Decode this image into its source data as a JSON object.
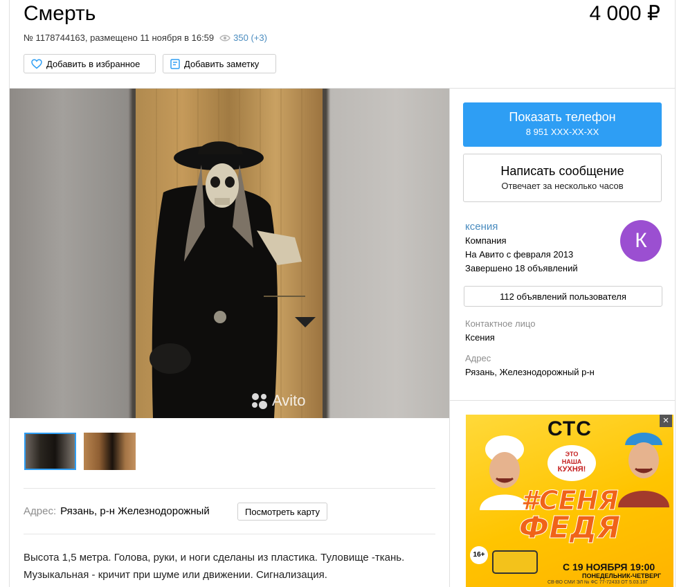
{
  "listing": {
    "title": "Смерть",
    "price": "4 000 ₽",
    "meta": "№ 1178744163, размещено 11 ноября в 16:59",
    "views": "350 (+3)",
    "favorite_label": "Добавить в избранное",
    "note_label": "Добавить заметку"
  },
  "gallery": {
    "watermark": "Avito"
  },
  "address_row": {
    "label": "Адрес:",
    "value": "Рязань, р-н Железнодорожный",
    "map_button": "Посмотреть карту"
  },
  "description": {
    "line1": "Высота 1,5 метра. Голова, руки, и ноги сделаны из пластика. Туловище -ткань.",
    "line2": "Музыкальная - кричит при шуме или движении. Сигнализация."
  },
  "contact": {
    "phone_button": "Показать телефон",
    "phone_masked": "8 951 XXX-XX-XX",
    "message_button": "Написать сообщение",
    "message_sub": "Отвечает за несколько часов"
  },
  "seller": {
    "name": "ксения",
    "type": "Компания",
    "since": "На Авито с февраля 2013",
    "completed": "Завершено 18 объявлений",
    "avatar_letter": "К",
    "listings_button": "112 объявлений пользователя",
    "contact_label": "Контактное лицо",
    "contact_value": "Ксения",
    "address_label": "Адрес",
    "address_value": "Рязань, Железнодорожный р-н"
  },
  "ad": {
    "brand": "СТС",
    "slogan_1": "ЭТО",
    "slogan_2": "НАША",
    "slogan_3": "КУХНЯ!",
    "show_line1": "#СЕНЯ",
    "show_line2": "ФЕДЯ",
    "age": "16+",
    "date": "С 19 НОЯБРЯ 19:00",
    "days": "ПОНЕДЕЛЬНИК-ЧЕТВЕРГ",
    "legal": "СВ-ВО СМИ ЭЛ № ФС 77-72433 ОТ 5.03.18Г",
    "close_icon": "×"
  },
  "colors": {
    "accent_blue": "#2e9ef4",
    "link_blue": "#4a8cbf",
    "avatar": "#9b4fd1"
  },
  "icons": [
    "heart-icon",
    "note-icon",
    "eye-icon",
    "avito-logo-icon",
    "close-icon"
  ]
}
